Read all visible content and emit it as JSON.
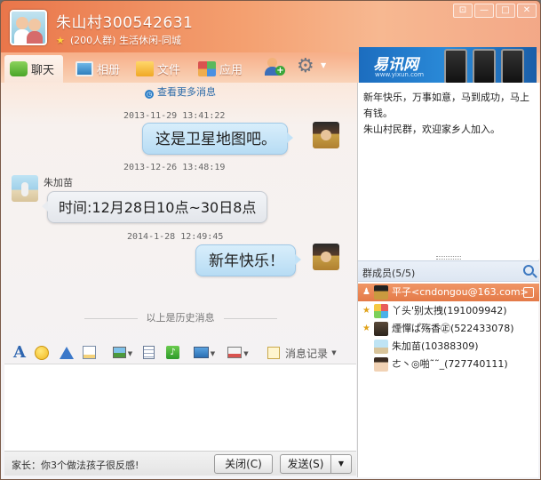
{
  "window": {
    "title": "朱山村300542631",
    "subtitle": "(200人群) 生活休闲-同城",
    "controls": [
      "⊡",
      "—",
      "□",
      "✕"
    ]
  },
  "toolbar": {
    "tabs": [
      {
        "label": "聊天",
        "icon": "chat-icon"
      },
      {
        "label": "相册",
        "icon": "photo-album-icon"
      },
      {
        "label": "文件",
        "icon": "folder-icon"
      },
      {
        "label": "应用",
        "icon": "apps-icon"
      }
    ]
  },
  "banner": {
    "logo": "易讯网",
    "url": "www.yixun.com"
  },
  "chat": {
    "more_link": "查看更多消息",
    "messages": [
      {
        "time": "2013-11-29 13:41:22",
        "sender": "",
        "text": "这是卫星地图吧。",
        "side": "right"
      },
      {
        "time": "2013-12-26 13:48:19",
        "sender": "朱加苗",
        "text": "时间:12月28日10点~30日8点",
        "side": "left"
      },
      {
        "time": "2014-1-28 12:49:45",
        "sender": "",
        "text": "新年快乐！",
        "side": "right"
      }
    ],
    "history_divider": "以上是历史消息"
  },
  "input_toolbar": {
    "font": "A",
    "record_label": "消息记录"
  },
  "bottom": {
    "tip": "家长：你3个做法孩子很反感!",
    "close_label": "关闭(C)",
    "send_label": "发送(S)"
  },
  "announcement": {
    "lines": [
      "新年快乐，万事如意，马到成功，马上有钱。",
      "朱山村民群，欢迎家乡人加入。"
    ]
  },
  "members": {
    "header": "群成员(5/5)",
    "list": [
      {
        "name": "平子<cndongou@163.com>",
        "role": "owner",
        "selected": true
      },
      {
        "name": "丫头'别太拽(191009942)",
        "role": "admin",
        "selected": false
      },
      {
        "name": "煙憚ぱ殇香㊣(522433078)",
        "role": "admin",
        "selected": false
      },
      {
        "name": "朱加苗(10388309)",
        "role": "member",
        "selected": false
      },
      {
        "name": "ㄜ丶◎啪˜˜_(727740111)",
        "role": "member",
        "selected": false
      }
    ]
  },
  "colors": {
    "header_orange": "#e9764a",
    "selected_member": "#e47a48",
    "bubble_blue": "#b7dcf4",
    "link_blue": "#2a6aa8"
  }
}
